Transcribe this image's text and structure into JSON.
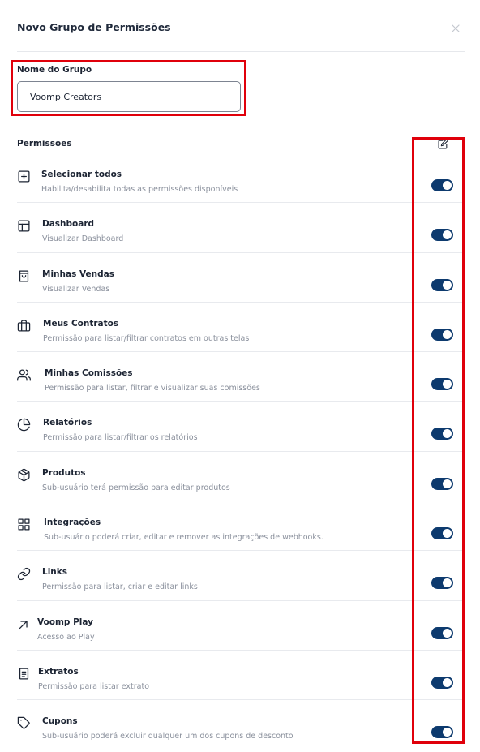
{
  "modal": {
    "title": "Novo Grupo de Permissões",
    "close_icon": "close-icon"
  },
  "group_name": {
    "label": "Nome do Grupo",
    "value": "Voomp Creators"
  },
  "permissions": {
    "title": "Permissões",
    "edit_icon": "edit-icon",
    "toggle_color": "#0d3a6e",
    "items": [
      {
        "icon": "plus-square-icon",
        "label": "Selecionar todos",
        "description": "Habilita/desabilita todas as permissões disponíveis",
        "enabled": true
      },
      {
        "icon": "layout-icon",
        "label": "Dashboard",
        "description": "Visualizar Dashboard",
        "enabled": true
      },
      {
        "icon": "shopping-bag-icon",
        "label": "Minhas Vendas",
        "description": "Visualizar Vendas",
        "enabled": true
      },
      {
        "icon": "briefcase-icon",
        "label": "Meus Contratos",
        "description": "Permissão para listar/filtrar contratos em outras telas",
        "enabled": true
      },
      {
        "icon": "users-icon",
        "label": "Minhas Comissões",
        "description": "Permissão para listar, filtrar e visualizar suas comissões",
        "enabled": true
      },
      {
        "icon": "pie-chart-icon",
        "label": "Relatórios",
        "description": "Permissão para listar/filtrar os relatórios",
        "enabled": true
      },
      {
        "icon": "package-icon",
        "label": "Produtos",
        "description": "Sub-usuário terá permissão para editar produtos",
        "enabled": true
      },
      {
        "icon": "grid-icon",
        "label": "Integrações",
        "description": "Sub-usuário poderá criar, editar e remover as integrações de webhooks.",
        "enabled": true
      },
      {
        "icon": "link-icon",
        "label": "Links",
        "description": "Permissão para listar, criar e editar links",
        "enabled": true
      },
      {
        "icon": "arrow-up-left-icon",
        "label": "Voomp Play",
        "description": "Acesso ao Play",
        "enabled": true
      },
      {
        "icon": "file-text-icon",
        "label": "Extratos",
        "description": "Permissão para listar extrato",
        "enabled": true
      },
      {
        "icon": "tag-icon",
        "label": "Cupons",
        "description": "Sub-usuário poderá excluir qualquer um dos cupons de desconto",
        "enabled": true
      }
    ]
  }
}
